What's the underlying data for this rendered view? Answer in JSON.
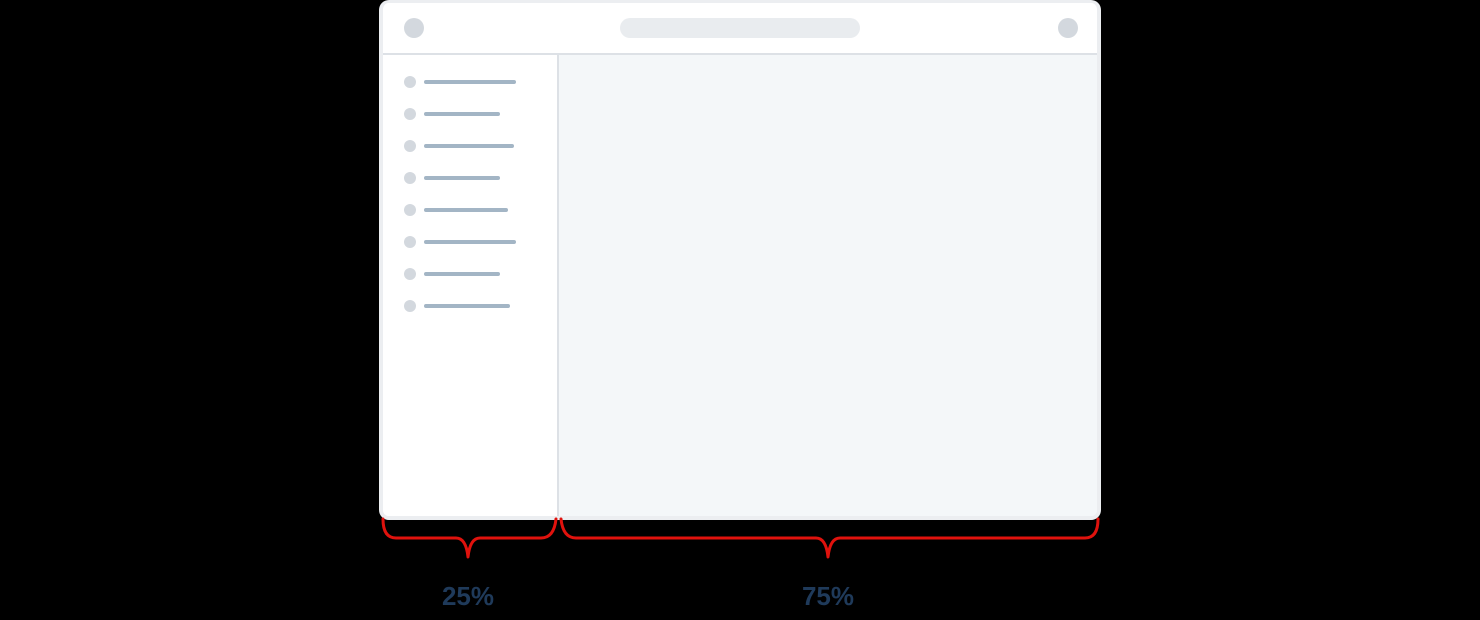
{
  "layout_diagram": {
    "sidebar_share_pct": 25,
    "main_share_pct": 75,
    "sidebar_item_count": 8,
    "labels": {
      "sidebar": "25%",
      "main": "75%"
    }
  },
  "colors": {
    "background": "#000000",
    "window_frame": "#eceef1",
    "placeholder_dot": "#d3d8de",
    "placeholder_line": "#a3b5c5",
    "address_bar": "#e9ecef",
    "main_area": "#f4f7f9",
    "brace": "#e0120d",
    "label_text": "#1f3a5a"
  },
  "icons": {
    "topbar_left": "circle-icon",
    "topbar_right": "circle-icon",
    "sidebar_bullet": "circle-icon"
  }
}
